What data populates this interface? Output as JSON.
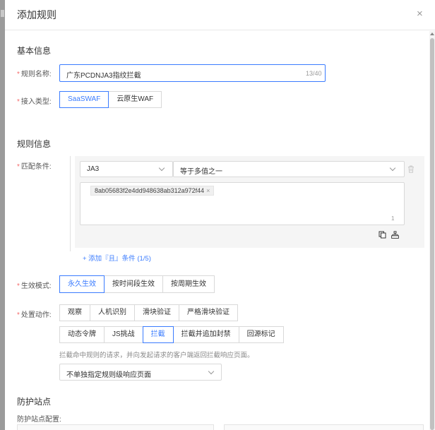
{
  "dialog": {
    "title": "添加规则",
    "close_glyph": "×"
  },
  "basic": {
    "section_title": "基本信息",
    "name_label": "规则名称:",
    "name_value": "广东PCDNJA3指纹拦截",
    "name_counter": "13/40",
    "access_label": "接入类型:",
    "access_options": [
      "SaaSWAF",
      "云原生WAF"
    ],
    "access_selected": "SaaSWAF"
  },
  "rule": {
    "section_title": "规则信息",
    "match_label": "匹配条件:",
    "field_select": "JA3",
    "operator_select": "等于多值之一",
    "tag_value": "8ab05683f2e4dd948638ab312a972f44",
    "tag_remove": "×",
    "value_count": "1",
    "add_condition": "+ 添加『且』条件 (1/5)",
    "icons": [
      "trash-icon",
      "copy-icon",
      "tree-icon"
    ]
  },
  "effect": {
    "label": "生效模式:",
    "options": [
      "永久生效",
      "按时间段生效",
      "按周期生效"
    ],
    "selected": "永久生效"
  },
  "action": {
    "label": "处置动作:",
    "row1": [
      "观察",
      "人机识别",
      "滑块验证",
      "严格滑块验证"
    ],
    "row2": [
      "动态令牌",
      "JS挑战",
      "拦截",
      "拦截并追加封禁",
      "回源标记"
    ],
    "selected": "拦截",
    "hint": "拦截命中规则的请求，并向发起请求的客户端返回拦截响应页面。",
    "page_select": "不单独指定规则级响应页面"
  },
  "protect": {
    "section_title": "防护站点",
    "config_label": "防护站点配置:"
  },
  "colors": {
    "accent": "#3b7cff",
    "required": "#f56c6c"
  }
}
